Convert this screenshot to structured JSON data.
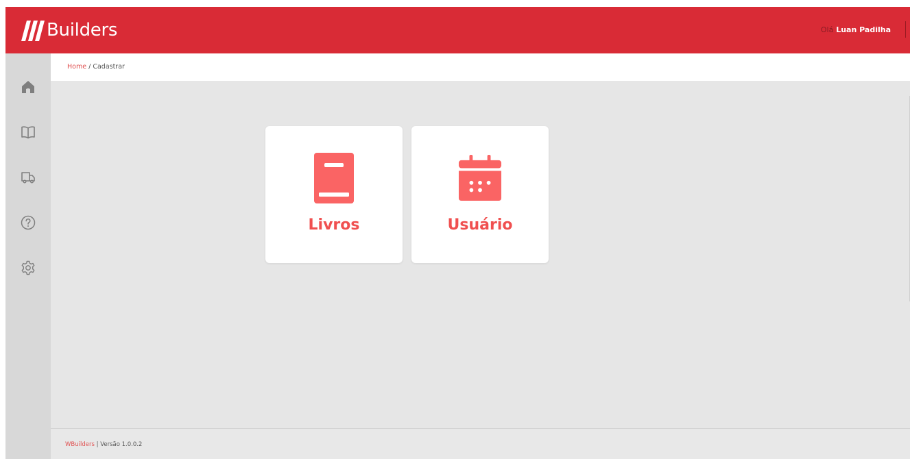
{
  "header": {
    "logo_text": "Builders",
    "greeting_hi": "Olá",
    "user_name": "Luan Padilha"
  },
  "sidebar": {
    "items": [
      {
        "icon": "home-icon"
      },
      {
        "icon": "book-open-icon"
      },
      {
        "icon": "truck-icon"
      },
      {
        "icon": "help-icon"
      },
      {
        "icon": "gear-icon"
      }
    ]
  },
  "breadcrumb": {
    "home": "Home",
    "separator": "/",
    "current": "Cadastrar"
  },
  "cards": [
    {
      "label": "Livros",
      "icon": "book-icon"
    },
    {
      "label": "Usuário",
      "icon": "calendar-icon"
    }
  ],
  "footer": {
    "brand": "WBuilders",
    "separator": "|",
    "version": "Versão 1.0.0.2"
  },
  "colors": {
    "brand_red": "#d92b36",
    "accent": "#f06060",
    "sidebar": "#d8d8d8",
    "content_bg": "#e6e6e6"
  }
}
